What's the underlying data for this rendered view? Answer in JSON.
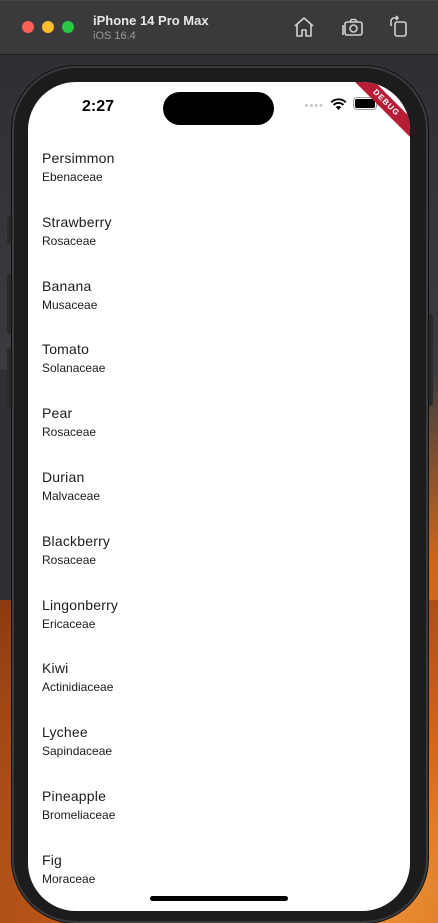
{
  "window": {
    "title": "iPhone 14 Pro Max",
    "subtitle": "iOS 16.4",
    "icons": [
      "home-icon",
      "screenshot-icon",
      "rotate-icon"
    ]
  },
  "status_bar": {
    "time": "2:27",
    "debug_banner": "DEBUG"
  },
  "fruits": [
    {
      "name": "Persimmon",
      "family": "Ebenaceae"
    },
    {
      "name": "Strawberry",
      "family": "Rosaceae"
    },
    {
      "name": "Banana",
      "family": "Musaceae"
    },
    {
      "name": "Tomato",
      "family": "Solanaceae"
    },
    {
      "name": "Pear",
      "family": "Rosaceae"
    },
    {
      "name": "Durian",
      "family": "Malvaceae"
    },
    {
      "name": "Blackberry",
      "family": "Rosaceae"
    },
    {
      "name": "Lingonberry",
      "family": "Ericaceae"
    },
    {
      "name": "Kiwi",
      "family": "Actinidiaceae"
    },
    {
      "name": "Lychee",
      "family": "Sapindaceae"
    },
    {
      "name": "Pineapple",
      "family": "Bromeliaceae"
    },
    {
      "name": "Fig",
      "family": "Moraceae"
    }
  ]
}
